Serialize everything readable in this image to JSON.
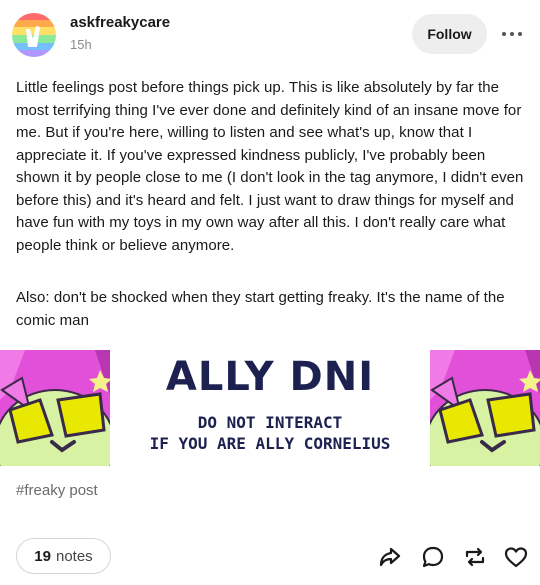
{
  "post": {
    "blog_name": "askfreakycare",
    "timestamp": "15h",
    "follow_label": "Follow",
    "paragraphs": [
      "Little feelings post before things pick up. This is like absolutely by far the most terrifying thing I've ever done and definitely kind of an insane move for me. But if you're here, willing to listen and see what's up, know that I appreciate it. If you've expressed kindness publicly, I've probably been shown it by people close to me (I don't look in the tag anymore, I didn't even before this) and it's heard and felt. I just want to draw things for myself and have fun with my toys in my own way after all this. I don't really care what people think or believe anymore.",
      "Also: don't be shocked when they start getting freaky. It's the name of the comic man"
    ],
    "image": {
      "title": "ALLY DNI",
      "line1": "DO NOT INTERACT",
      "line2": "IF YOU ARE ALLY CORNELIUS"
    },
    "tag": "#freaky post",
    "notes_count": "19",
    "notes_label": "notes"
  },
  "icons": {
    "more": "ellipsis-icon",
    "share": "share-icon",
    "reply": "reply-bubble-icon",
    "reblog": "reblog-icon",
    "like": "heart-icon"
  },
  "colors": {
    "follow_bg": "#eeeeee",
    "banner_ink": "#1c2150",
    "character_pink": "#e24fd8",
    "character_green": "#d7f2a3",
    "character_yellow": "#e8e800"
  }
}
